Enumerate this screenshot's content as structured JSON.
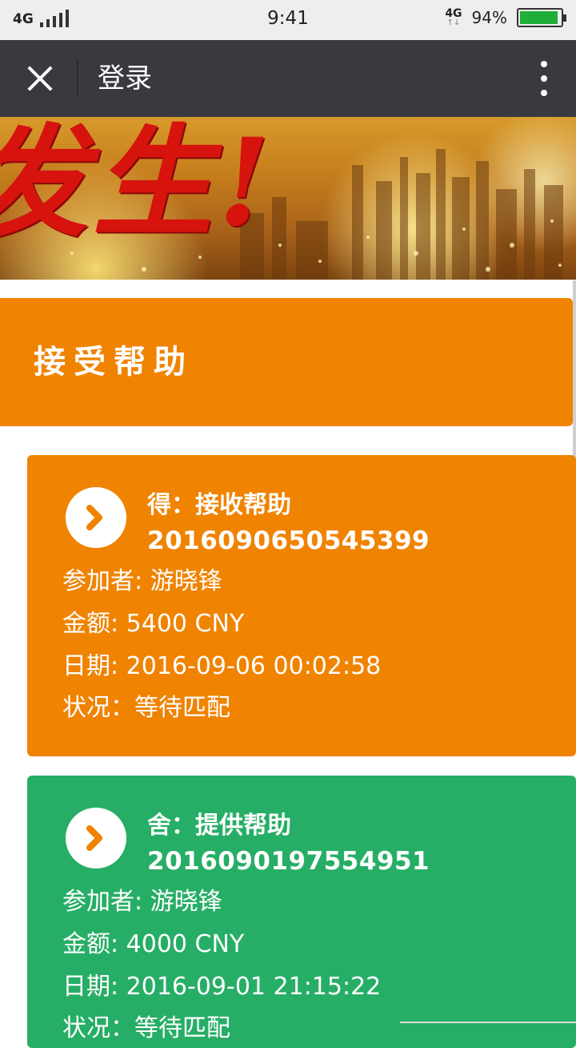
{
  "status_bar": {
    "network_left": "4G",
    "time": "9:41",
    "network_right": "4G",
    "battery_percent": "94%",
    "battery_level": 0.94,
    "battery_color": "#1fae3a"
  },
  "nav": {
    "title": "登录",
    "close_icon": "close-icon",
    "menu_icon": "more-vertical-icon"
  },
  "banner": {
    "text": "发生!"
  },
  "section": {
    "title": "接受帮助",
    "color": "#f08300"
  },
  "cards": [
    {
      "heading": "得：接收帮助",
      "number": "2016090650545399",
      "participant": "参加者: 游晓锋",
      "amount": "金额: 5400 CNY",
      "date": "日期: 2016-09-06 00:02:58",
      "status": "状况：等待匹配",
      "color": "#f08300",
      "icon": "chevron-right-icon"
    },
    {
      "heading": "舍：提供帮助",
      "number": "2016090197554951",
      "participant": "参加者: 游晓锋",
      "amount": "金额: 4000 CNY",
      "date": "日期: 2016-09-01 21:15:22",
      "status": "状况：等待匹配",
      "color": "#27ae66",
      "icon": "chevron-right-icon"
    }
  ]
}
